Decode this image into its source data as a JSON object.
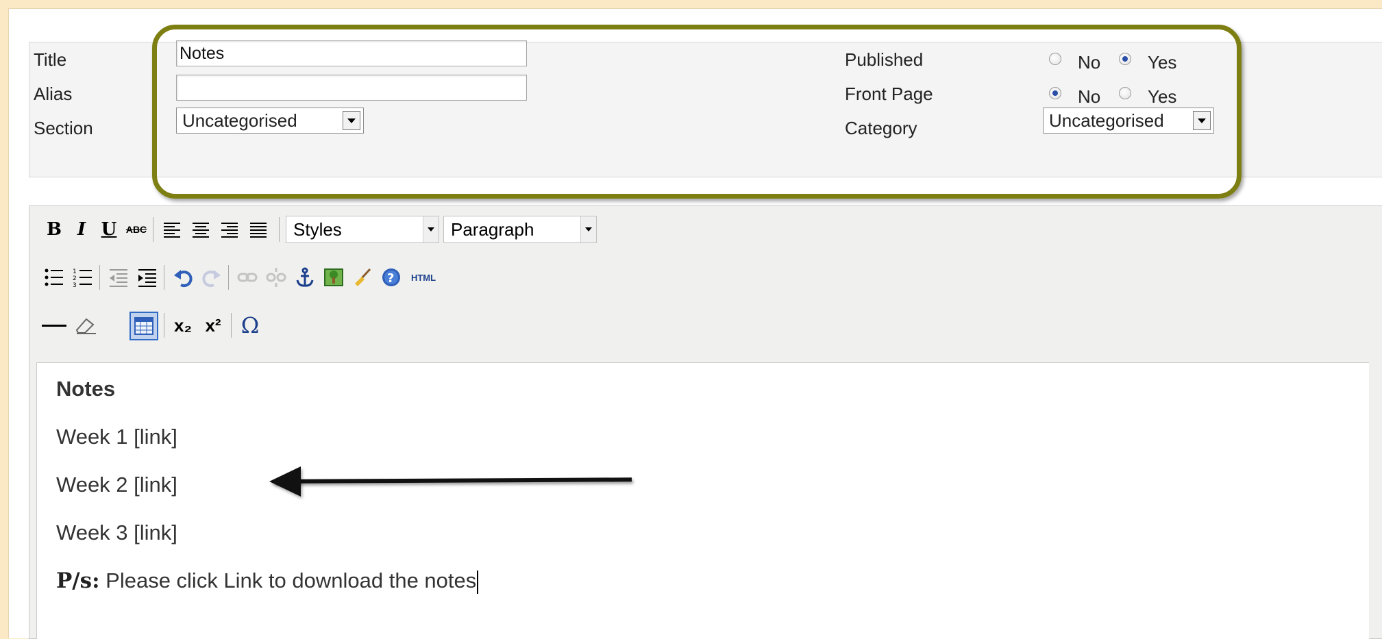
{
  "details": {
    "title_label": "Title",
    "title_value": "Notes",
    "alias_label": "Alias",
    "alias_value": "",
    "section_label": "Section",
    "section_value": "Uncategorised",
    "published_label": "Published",
    "published_options": [
      "No",
      "Yes"
    ],
    "published_selected": "Yes",
    "frontpage_label": "Front Page",
    "frontpage_options": [
      "No",
      "Yes"
    ],
    "frontpage_selected": "No",
    "category_label": "Category",
    "category_value": "Uncategorised"
  },
  "toolbar": {
    "row1": [
      "bold",
      "italic",
      "underline",
      "strikethrough",
      "align-left",
      "align-center",
      "align-right",
      "align-justify"
    ],
    "bold_glyph": "B",
    "italic_glyph": "I",
    "underline_glyph": "U",
    "strike_glyph": "ABC",
    "styles_label": "Styles",
    "format_label": "Paragraph",
    "row2": [
      "unordered-list",
      "ordered-list",
      "outdent",
      "indent",
      "undo",
      "redo",
      "link",
      "unlink",
      "anchor",
      "image",
      "cleanup",
      "help",
      "html"
    ],
    "html_label": "HTML",
    "row3": [
      "horizontal-rule",
      "remove-format",
      "table",
      "subscript",
      "superscript",
      "special-character"
    ],
    "subscript_glyph": "x₂",
    "superscript_glyph": "x²",
    "omega_glyph": "Ω"
  },
  "content": {
    "heading": "Notes",
    "lines": [
      "Week 1 [link]",
      "Week 2 [link]",
      "Week 3 [link]"
    ],
    "note_prefix": "P/s:",
    "note_text": " Please click Link to download the notes"
  },
  "colors": {
    "highlight_oval": "#7d7f12",
    "page_background": "#fbe9c6",
    "panel_background": "#f4f4f4"
  }
}
